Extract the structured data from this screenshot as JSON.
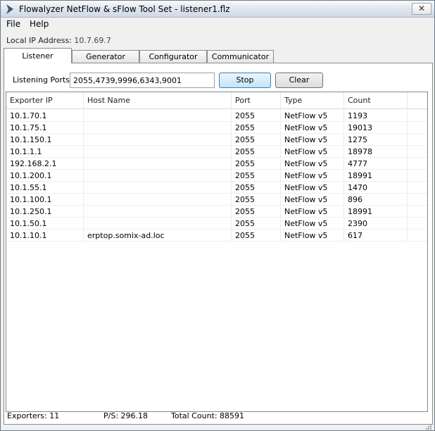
{
  "window": {
    "title": "Flowalyzer NetFlow & sFlow Tool Set - listener1.flz",
    "close_label": "✕"
  },
  "menu": [
    "File",
    "Help"
  ],
  "local_ip": {
    "label": "Local IP Address:",
    "value": "10.7.69.7"
  },
  "tabs": [
    "Listener",
    "Generator",
    "Configurator",
    "Communicator"
  ],
  "active_tab": "Listener",
  "listener": {
    "ports_label": "Listening Ports:",
    "ports_value": "2055,4739,9996,6343,9001",
    "stop_label": "Stop",
    "clear_label": "Clear"
  },
  "table": {
    "columns": [
      "Exporter IP",
      "Host Name",
      "Port",
      "Type",
      "Count"
    ],
    "rows": [
      [
        "10.1.70.1",
        "",
        "2055",
        "NetFlow v5",
        "1193"
      ],
      [
        "10.1.75.1",
        "",
        "2055",
        "NetFlow v5",
        "19013"
      ],
      [
        "10.1.150.1",
        "",
        "2055",
        "NetFlow v5",
        "1275"
      ],
      [
        "10.1.1.1",
        "",
        "2055",
        "NetFlow v5",
        "18978"
      ],
      [
        "192.168.2.1",
        "",
        "2055",
        "NetFlow v5",
        "4777"
      ],
      [
        "10.1.200.1",
        "",
        "2055",
        "NetFlow v5",
        "18991"
      ],
      [
        "10.1.55.1",
        "",
        "2055",
        "NetFlow v5",
        "1470"
      ],
      [
        "10.1.100.1",
        "",
        "2055",
        "NetFlow v5",
        "896"
      ],
      [
        "10.1.250.1",
        "",
        "2055",
        "NetFlow v5",
        "18991"
      ],
      [
        "10.1.50.1",
        "",
        "2055",
        "NetFlow v5",
        "2390"
      ],
      [
        "10.1.10.1",
        "erptop.somix-ad.loc",
        "2055",
        "NetFlow v5",
        "617"
      ]
    ]
  },
  "status": {
    "exporters": "Exporters:  11",
    "ps": "P/S:  296.18",
    "total": "Total Count:  88591"
  }
}
